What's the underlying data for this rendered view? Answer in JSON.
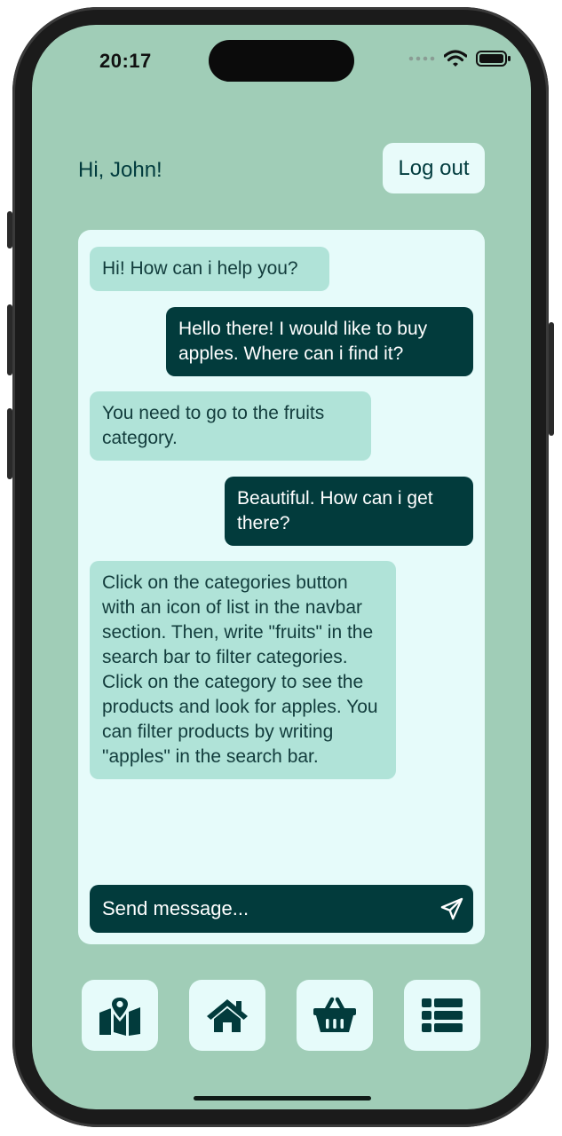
{
  "status_bar": {
    "time": "20:17"
  },
  "header": {
    "greeting": "Hi, John!",
    "logout_label": "Log out"
  },
  "chat": {
    "messages": [
      {
        "sender": "bot",
        "text": "Hi! How can i help you?"
      },
      {
        "sender": "user",
        "text": "Hello there! I would like to buy apples. Where can i find it?"
      },
      {
        "sender": "bot",
        "text": "You need to go to the fruits category."
      },
      {
        "sender": "user",
        "text": "Beautiful. How can i get there?"
      },
      {
        "sender": "bot",
        "text": "Click on the categories button with an icon of list in the navbar section. Then, write \"fruits\" in the search bar to filter categories. Click on the category to see the products and look for apples. You can filter products by writing \"apples\" in the search bar."
      }
    ],
    "input_placeholder": "Send message..."
  },
  "navbar": {
    "items": [
      {
        "icon": "map-location-icon"
      },
      {
        "icon": "home-icon"
      },
      {
        "icon": "basket-icon"
      },
      {
        "icon": "list-icon"
      }
    ]
  },
  "colors": {
    "background": "#a0cdb7",
    "panel": "#e6fbfa",
    "primary_dark": "#023b3c",
    "bot_bubble": "#b0e3d8"
  }
}
